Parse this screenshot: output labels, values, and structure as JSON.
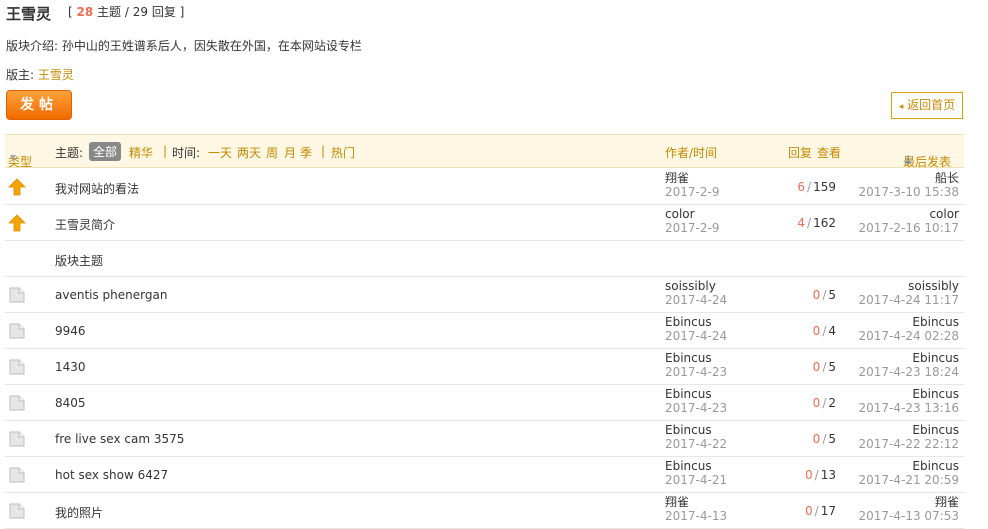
{
  "forum": {
    "title": "王雪灵",
    "stats_open": "[",
    "threads": "28",
    "threads_label": "主题 /",
    "replies": "29",
    "replies_label": "回复 ]",
    "desc": "版块介绍: 孙中山的王姓谱系后人，因失散在外国，在本网站设专栏",
    "moderator_label": "版主:",
    "moderator": "王雪灵"
  },
  "toolbar": {
    "post_label": "发帖",
    "back_label": "返回首页"
  },
  "filter": {
    "type": "类型",
    "theme": "主题:",
    "all": "全部",
    "jinghua": "精华",
    "sep": "|",
    "time": "时间:",
    "day1": "一天",
    "day2": "两天",
    "week": "周",
    "month": "月",
    "season": "季",
    "hot": "热门",
    "author_time": "作者/时间",
    "replies": "回复",
    "views": "查看",
    "last_post": "最后发表",
    "sort_arrow": "↓"
  },
  "pinned": [
    {
      "title": "我对网站的看法",
      "author": "翔雀",
      "date": "2017-2-9",
      "replies": "6",
      "views": "159",
      "last_user": "船长",
      "last_time": "2017-3-10 15:38"
    },
    {
      "title": "王雪灵简介",
      "author": "color",
      "date": "2017-2-9",
      "replies": "4",
      "views": "162",
      "last_user": "color",
      "last_time": "2017-2-16 10:17"
    }
  ],
  "section_label": "版块主题",
  "threads": [
    {
      "title": "aventis phenergan",
      "author": "soissibly",
      "date": "2017-4-24",
      "replies": "0",
      "views": "5",
      "last_user": "soissibly",
      "last_time": "2017-4-24 11:17"
    },
    {
      "title": "9946",
      "author": "Ebincus",
      "date": "2017-4-24",
      "replies": "0",
      "views": "4",
      "last_user": "Ebincus",
      "last_time": "2017-4-24 02:28"
    },
    {
      "title": "1430",
      "author": "Ebincus",
      "date": "2017-4-23",
      "replies": "0",
      "views": "5",
      "last_user": "Ebincus",
      "last_time": "2017-4-23 18:24"
    },
    {
      "title": "8405",
      "author": "Ebincus",
      "date": "2017-4-23",
      "replies": "0",
      "views": "2",
      "last_user": "Ebincus",
      "last_time": "2017-4-23 13:16"
    },
    {
      "title": "fre live sex cam 3575",
      "author": "Ebincus",
      "date": "2017-4-22",
      "replies": "0",
      "views": "5",
      "last_user": "Ebincus",
      "last_time": "2017-4-22 22:12"
    },
    {
      "title": "hot sex show 6427",
      "author": "Ebincus",
      "date": "2017-4-21",
      "replies": "0",
      "views": "13",
      "last_user": "Ebincus",
      "last_time": "2017-4-21 20:59"
    },
    {
      "title": "我的照片",
      "author": "翔雀",
      "date": "2017-4-13",
      "replies": "0",
      "views": "17",
      "last_user": "翔雀",
      "last_time": "2017-4-13 07:53"
    }
  ],
  "colors": {
    "accent": "#c58a00",
    "reply_count": "#f26c4f",
    "header_bg": "#fdf7e4",
    "post_button": "#ef6a00"
  },
  "icons": {
    "pinned": "pin-up-arrow-icon",
    "normal": "folder-icon"
  }
}
